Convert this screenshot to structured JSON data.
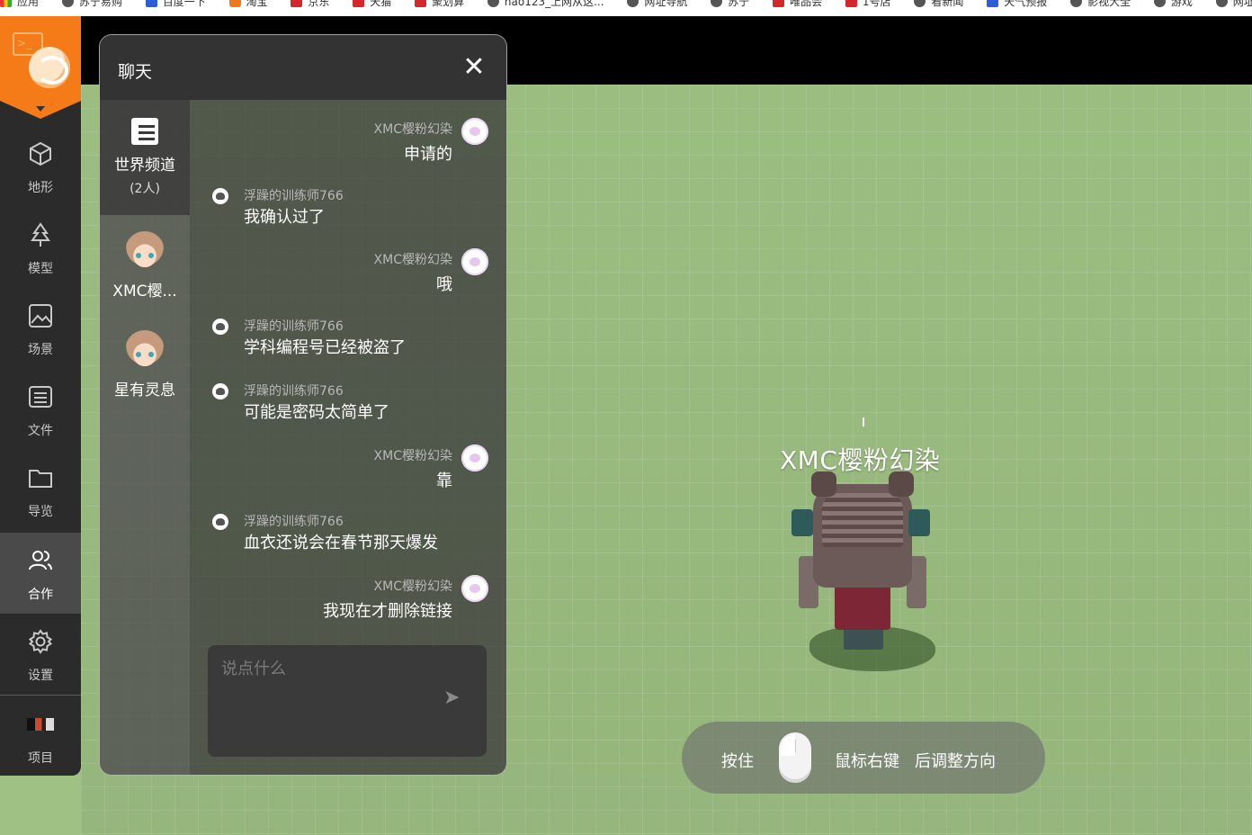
{
  "bookmarks": [
    "应用",
    "苏宁易购",
    "百度一下",
    "淘宝",
    "京东",
    "天猫",
    "聚划算",
    "hao123_上网从这...",
    "网址导航",
    "苏宁",
    "唯品会",
    "1号店",
    "看新闻",
    "天气预报",
    "影视大全",
    "游戏",
    "网址大全"
  ],
  "sidebar": {
    "items": [
      {
        "label": "地形",
        "icon": "cube-icon"
      },
      {
        "label": "模型",
        "icon": "tree-icon"
      },
      {
        "label": "场景",
        "icon": "image-icon"
      },
      {
        "label": "文件",
        "icon": "list-file-icon"
      },
      {
        "label": "导览",
        "icon": "folder-icon"
      },
      {
        "label": "合作",
        "icon": "users-icon"
      },
      {
        "label": "设置",
        "icon": "gear-icon"
      },
      {
        "label": "项目",
        "icon": "project-thumbnail"
      }
    ]
  },
  "chat": {
    "title": "聊天",
    "close_glyph": "✕",
    "channels": [
      {
        "name": "世界频道",
        "count": "(2人)"
      },
      {
        "name": "XMC樱..."
      },
      {
        "name": "星有灵息"
      }
    ],
    "messages": [
      {
        "user": "XMC樱粉幻染",
        "text": "申请的",
        "side": "right"
      },
      {
        "user": "浮躁的训练师766",
        "text": "我确认过了",
        "side": "left"
      },
      {
        "user": "XMC樱粉幻染",
        "text": "哦",
        "side": "right"
      },
      {
        "user": "浮躁的训练师766",
        "text": "学科编程号已经被盗了",
        "side": "left"
      },
      {
        "user": "浮躁的训练师766",
        "text": "可能是密码太简单了",
        "side": "left"
      },
      {
        "user": "XMC樱粉幻染",
        "text": "靠",
        "side": "right"
      },
      {
        "user": "浮躁的训练师766",
        "text": "血衣还说会在春节那天爆发",
        "side": "left"
      },
      {
        "user": "XMC樱粉幻染",
        "text": "我现在才删除链接",
        "side": "right"
      }
    ],
    "input_placeholder": "说点什么",
    "send_glyph": "➤"
  },
  "scene": {
    "avatar_name": "XMC樱粉幻染"
  },
  "hint": {
    "press": "按住",
    "right_button": "鼠标右键",
    "adjust": "后调整方向"
  },
  "colors": {
    "accent": "#f57b18",
    "ground": "#9ec183",
    "sidebar": "#2b2b2b"
  }
}
